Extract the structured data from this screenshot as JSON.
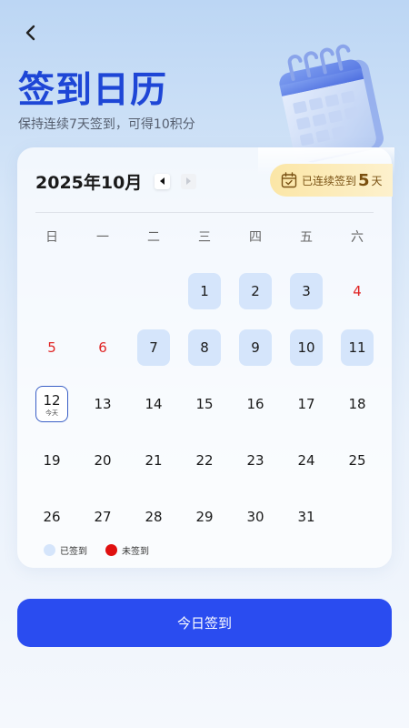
{
  "header": {
    "title": "签到日历",
    "subtitle": "保持连续7天签到，可得10积分"
  },
  "calendar": {
    "month_label": "2025年10月",
    "streak_prefix": "已连续签到",
    "streak_days": "5",
    "streak_suffix": "天",
    "weekdays": [
      "日",
      "一",
      "二",
      "三",
      "四",
      "五",
      "六"
    ],
    "leading_blanks": 3,
    "today_tag": "今天",
    "days": [
      {
        "d": "1",
        "state": "signed"
      },
      {
        "d": "2",
        "state": "signed"
      },
      {
        "d": "3",
        "state": "signed"
      },
      {
        "d": "4",
        "state": "missed"
      },
      {
        "d": "5",
        "state": "missed"
      },
      {
        "d": "6",
        "state": "missed"
      },
      {
        "d": "7",
        "state": "signed"
      },
      {
        "d": "8",
        "state": "signed"
      },
      {
        "d": "9",
        "state": "signed"
      },
      {
        "d": "10",
        "state": "signed"
      },
      {
        "d": "11",
        "state": "signed"
      },
      {
        "d": "12",
        "state": "today"
      },
      {
        "d": "13",
        "state": "normal"
      },
      {
        "d": "14",
        "state": "normal"
      },
      {
        "d": "15",
        "state": "normal"
      },
      {
        "d": "16",
        "state": "normal"
      },
      {
        "d": "17",
        "state": "normal"
      },
      {
        "d": "18",
        "state": "normal"
      },
      {
        "d": "19",
        "state": "normal"
      },
      {
        "d": "20",
        "state": "normal"
      },
      {
        "d": "21",
        "state": "normal"
      },
      {
        "d": "22",
        "state": "normal"
      },
      {
        "d": "23",
        "state": "normal"
      },
      {
        "d": "24",
        "state": "normal"
      },
      {
        "d": "25",
        "state": "normal"
      },
      {
        "d": "26",
        "state": "normal"
      },
      {
        "d": "27",
        "state": "normal"
      },
      {
        "d": "28",
        "state": "normal"
      },
      {
        "d": "29",
        "state": "normal"
      },
      {
        "d": "30",
        "state": "normal"
      },
      {
        "d": "31",
        "state": "normal"
      }
    ]
  },
  "legend": {
    "signed_label": "已签到",
    "missed_label": "未签到"
  },
  "action": {
    "signin_label": "今日签到"
  },
  "colors": {
    "accent": "#2a4cf0",
    "signed": "#d5e5fb",
    "missed": "#e02424",
    "title": "#1e46d6"
  },
  "icons": {
    "back": "chevron-left-icon",
    "prev": "caret-left-icon",
    "next": "caret-right-icon",
    "streak": "calendar-check-icon",
    "hero": "calendar-illustration"
  }
}
